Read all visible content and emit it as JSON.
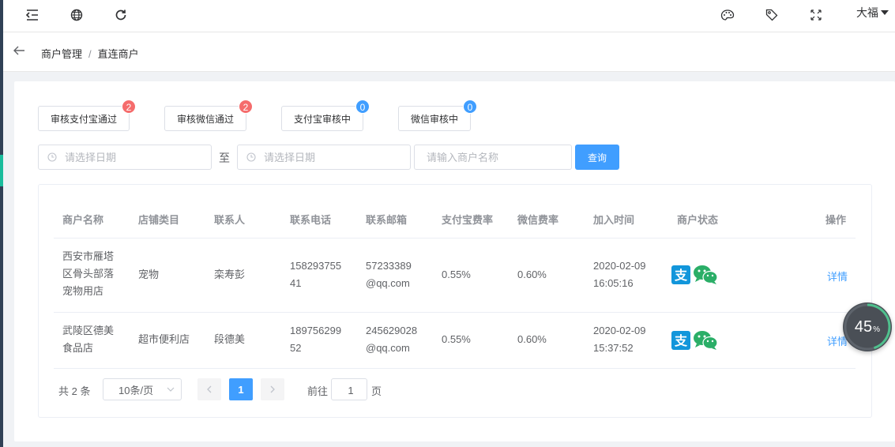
{
  "topbar": {
    "user_name": "大福",
    "left_icons": [
      "menu-fold-icon",
      "globe-icon",
      "refresh-icon"
    ],
    "right_icons": [
      "palette-icon",
      "tag-icon",
      "fullscreen-icon"
    ]
  },
  "breadcrumb": {
    "items": [
      "商户管理",
      "直连商户"
    ]
  },
  "status_buttons": [
    {
      "label": "审核支付宝通过",
      "count": "2",
      "badge_color": "#f56c6c"
    },
    {
      "label": "审核微信通过",
      "count": "2",
      "badge_color": "#f56c6c"
    },
    {
      "label": "支付宝审核中",
      "count": "0",
      "badge_color": "#409eff"
    },
    {
      "label": "微信审核中",
      "count": "0",
      "badge_color": "#409eff"
    }
  ],
  "filters": {
    "start_date_placeholder": "请选择日期",
    "to_label": "至",
    "end_date_placeholder": "请选择日期",
    "name_placeholder": "请输入商户名称",
    "query_label": "查询"
  },
  "table": {
    "columns": [
      "商户名称",
      "店铺类目",
      "联系人",
      "联系电话",
      "联系邮箱",
      "支付宝费率",
      "微信费率",
      "加入时间",
      "商户状态",
      "操作"
    ],
    "rows": [
      {
        "name_lines": [
          "西安市雁塔",
          "区骨头部落",
          "宠物用店"
        ],
        "category": "宠物",
        "contact": "栾寿彭",
        "phone_lines": [
          "158293755",
          "41"
        ],
        "email_lines": [
          "57233389",
          "@qq.com"
        ],
        "alipay_rate": "0.55%",
        "wechat_rate": "0.60%",
        "time_lines": [
          "2020-02-09",
          "16:05:16"
        ],
        "status_icons": [
          "alipay-icon",
          "wechat-icon"
        ],
        "action": "详情"
      },
      {
        "name_lines": [
          "武陵区德美",
          "食品店"
        ],
        "category": "超市便利店",
        "contact": "段德美",
        "phone_lines": [
          "189756299",
          "52"
        ],
        "email_lines": [
          "245629028",
          "@qq.com"
        ],
        "alipay_rate": "0.55%",
        "wechat_rate": "0.60%",
        "time_lines": [
          "2020-02-09",
          "15:37:52"
        ],
        "status_icons": [
          "alipay-icon",
          "wechat-icon"
        ],
        "action": "详情"
      }
    ]
  },
  "pagination": {
    "total_text": "共 2 条",
    "page_size": "10条/页",
    "current_page": "1",
    "goto_prefix": "前往",
    "goto_value": "1",
    "goto_suffix": "页"
  },
  "progress_widget": {
    "value": "45",
    "unit": "%",
    "fraction": 0.45
  },
  "colors": {
    "primary": "#409eff",
    "danger": "#f56c6c",
    "alipay": "#1296db",
    "wechat": "#2aae67",
    "sidebar": "#304156",
    "sidebar_active": "#1abc9c"
  }
}
